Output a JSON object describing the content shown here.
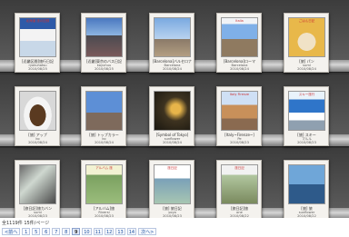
{
  "books": [
    {
      "title": "[近畿区間]旅行日記",
      "author": "ryokuhatsu",
      "date": "2010/08/25",
      "thumb_label": "北海道 旅の記録"
    },
    {
      "title": "[近畿]東京のバス日記",
      "author": "koyuhuu",
      "date": "2010/08/25",
      "thumb_label": ""
    },
    {
      "title": "[Barcelona]バルセロナ",
      "author": "Barcelona",
      "date": "2010/08/24",
      "thumb_label": ""
    },
    {
      "title": "[Barcelona]ローマ",
      "author": "Barcelona",
      "date": "2010/08/24",
      "thumb_label": "Italia"
    },
    {
      "title": "[旅] パン",
      "author": "sumi",
      "date": "2010/08/24",
      "thumb_label": "ごはん日記"
    },
    {
      "title": "[旅] アップ",
      "author": "ko",
      "date": "2010/08/24",
      "thumb_label": ""
    },
    {
      "title": "[旅] トップカラー",
      "author": "ko",
      "date": "2010/08/24",
      "thumb_label": ""
    },
    {
      "title": "[Symbol of Tokyo]",
      "author": "sunflower",
      "date": "2010/08/24",
      "thumb_label": ""
    },
    {
      "title": "[Italy~Firenze~]",
      "author": "Pe",
      "date": "2010/08/23",
      "thumb_label": "Italy Firenze"
    },
    {
      "title": "[旅] スキー",
      "author": "マルル",
      "date": "2010/08/23",
      "thumb_label": "スキー旅行"
    },
    {
      "title": "[旅日記]旅カバン",
      "author": "sumi",
      "date": "2010/08/23",
      "thumb_label": ""
    },
    {
      "title": "[アルバム]旅",
      "author": "Riversi",
      "date": "2010/08/23",
      "thumb_label": "アルバム 旅"
    },
    {
      "title": "[旅] 旅日記",
      "author": "yoyo",
      "date": "2010/08/23",
      "thumb_label": "旅日記"
    },
    {
      "title": "[旅日記]旅",
      "author": "one",
      "date": "2010/08/22",
      "thumb_label": "旅日記"
    },
    {
      "title": "[旅] 旅",
      "author": "sunflower",
      "date": "2010/08/22",
      "thumb_label": ""
    }
  ],
  "results": {
    "text": "全1119件 15件/ページ"
  },
  "pager": {
    "prev": "<前へ",
    "pages": [
      "1",
      "5",
      "6",
      "7",
      "8",
      "9",
      "10",
      "11",
      "12",
      "13",
      "14"
    ],
    "current": "9",
    "next": "次へ>"
  }
}
